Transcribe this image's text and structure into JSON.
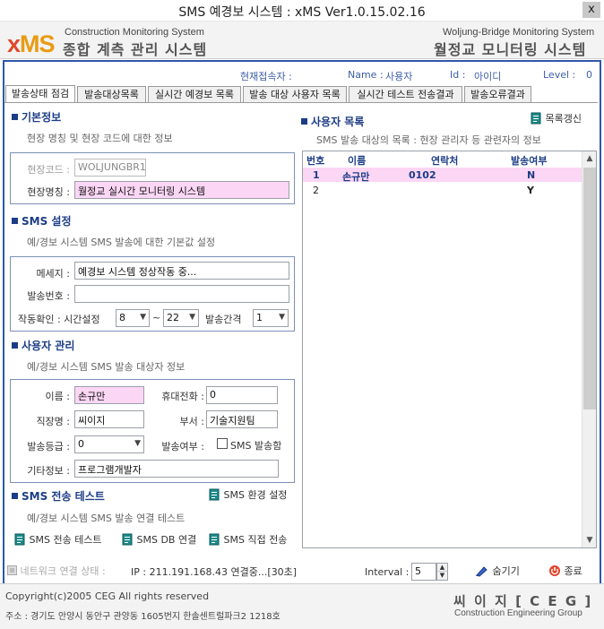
{
  "window": {
    "title": "SMS 예경보 시스템 : xMS Ver1.0.15.02.16",
    "close": "x"
  },
  "header": {
    "logo_x": "x",
    "logo_ms": "MS",
    "left_en": "Construction  Monitoring System",
    "left_ko": "종합 계측 관리 시스템",
    "right_en": "Woljung-Bridge  Monitoring System",
    "right_ko": "월정교 모니터링 시스템"
  },
  "user_info": {
    "current_label": "현재접속자 :",
    "name_label": "Name :",
    "name_value": "사용자",
    "id_label": "Id :",
    "id_value": "아이디",
    "level_label": "Level :",
    "level_value": "0"
  },
  "tabs": [
    "발송상태 점검",
    "발송대상목록",
    "실시간 예경보 목록",
    "발송 대상 사용자 목록",
    "실시간 테스트 전송결과",
    "발송오류결과"
  ],
  "basic": {
    "title": "기본정보",
    "desc": "현장 명칭 및 현장 코드에 대한 정보",
    "code_label": "현장코드 :",
    "code_value": "WOLJUNGBR1",
    "name_label": "현장명칭 :",
    "name_value": "월정교 실시간 모니터링 시스템"
  },
  "sms": {
    "title": "SMS 설정",
    "desc": "예/경보 시스템 SMS 발송에 대한 기본값 설정",
    "message_label": "메세지 :",
    "message_value": "예경보 시스템 정상작동 중...",
    "number_label": "발송번호 :",
    "number_value": "",
    "check_label": "작동확인 : 시간설정",
    "time_from": "8",
    "tilde": "~",
    "time_to": "22",
    "interval_label": "발송간격",
    "interval_value": "1"
  },
  "user_mgmt": {
    "title": "사용자 관리",
    "desc": "예/경보 시스템 SMS 발송 대상자 정보",
    "name_label": "이름 :",
    "name_value": "손규만",
    "phone_label": "휴대전화 :",
    "phone_value": "0",
    "company_label": "직장명 :",
    "company_value": "씨이지",
    "dept_label": "부서 :",
    "dept_value": "기술지원팀",
    "grade_label": "발송등급 :",
    "grade_value": "0",
    "send_label": "발송여부 :",
    "send_check_label": "SMS 발송함",
    "etc_label": "기타정보 :",
    "etc_value": "프로그램개발자"
  },
  "sms_test": {
    "title": "SMS 전송 테스트",
    "env_btn": "SMS 환경 설정",
    "desc": "예/경보 시스템 SMS 발송 연결 테스트",
    "test_btn": "SMS 전송 테스트",
    "db_btn": "SMS DB 연결",
    "direct_btn": "SMS 직접 전송"
  },
  "user_list": {
    "title": "사용자 목록",
    "refresh_btn": "목록갱신",
    "desc": "SMS 발송 대상의 목록 : 현장 관리자 등 관련자의 정보",
    "columns": [
      "번호",
      "이름",
      "연락처",
      "발송여부"
    ],
    "rows": [
      [
        "1",
        "손규만",
        "0102",
        "N"
      ],
      [
        "2",
        "",
        "",
        "Y"
      ]
    ]
  },
  "status": {
    "net_label": "네트워크 연결 상태 :",
    "ip_text": "IP : 211.191.168.43 연결중...[30초]",
    "interval_label": "Interval :",
    "interval_value": "5",
    "hide_btn": "숨기기",
    "exit_btn": "종료"
  },
  "footer": {
    "copyright": "Copyright(c)2005 CEG All rights reserved",
    "address": "주소 : 경기도 안양시 동안구 관양동 1605번지 한솔센트럴파크2 1218호",
    "company_ko": "씨 이 지 [ C E G ]",
    "company_en": "Construction  Engineering Group"
  },
  "colors": {
    "accent": "#2f57a9",
    "pink": "#fcd6f5",
    "logo_x": "#e0492a",
    "logo_ms": "#e89b12"
  }
}
